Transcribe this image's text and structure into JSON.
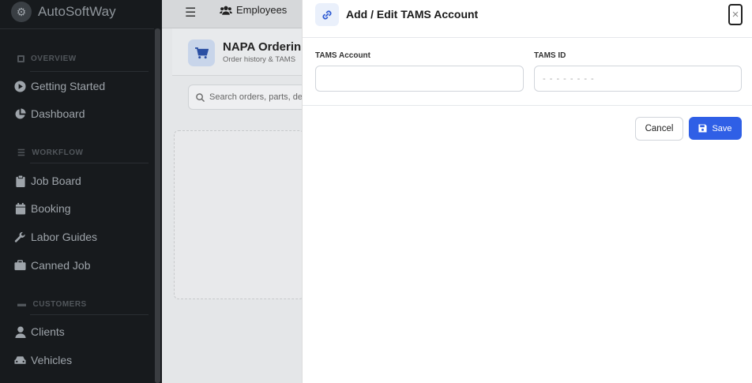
{
  "sidebar": {
    "brand": "AutoSoftWay",
    "sections": [
      {
        "label": "OVERVIEW"
      },
      {
        "label": "WORKFLOW"
      },
      {
        "label": "CUSTOMERS"
      }
    ],
    "items": [
      {
        "label": "Getting Started",
        "icon": "play-circle-icon"
      },
      {
        "label": "Dashboard",
        "icon": "pie-chart-icon"
      },
      {
        "label": "Job Board",
        "icon": "clipboard-icon"
      },
      {
        "label": "Booking",
        "icon": "calendar-icon"
      },
      {
        "label": "Labor Guides",
        "icon": "wrench-icon"
      },
      {
        "label": "Canned Job",
        "icon": "briefcase-icon"
      },
      {
        "label": "Clients",
        "icon": "user-icon"
      },
      {
        "label": "Vehicles",
        "icon": "car-icon"
      }
    ]
  },
  "topbar": {
    "employees_label": "Employees"
  },
  "page": {
    "title": "NAPA Orderin",
    "subtitle": "Order history & TAMS",
    "search_placeholder": "Search orders, parts, de"
  },
  "modal": {
    "title": "Add / Edit TAMS Account",
    "close_label": "×",
    "fields": {
      "account_label": "TAMS Account",
      "account_value": "",
      "id_label": "TAMS ID",
      "id_placeholder": "- - - - - - - -"
    },
    "cancel_label": "Cancel",
    "save_label": "Save"
  },
  "colors": {
    "sidebar_bg": "#171a1d",
    "accent": "#2f5fe6"
  }
}
